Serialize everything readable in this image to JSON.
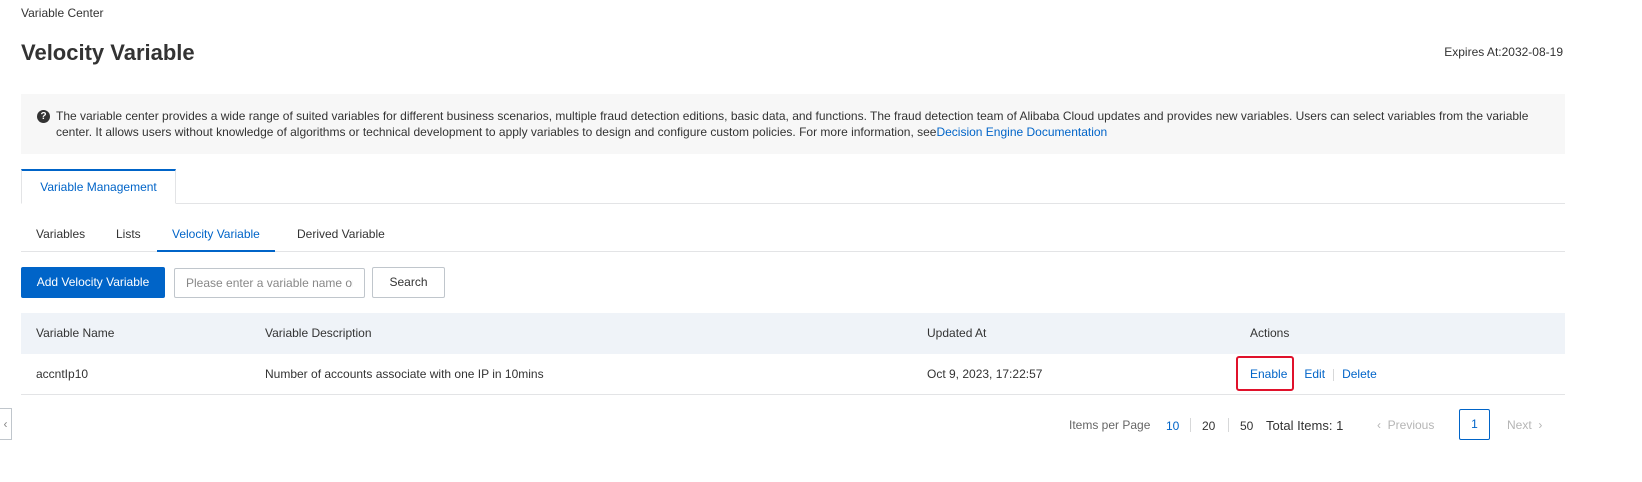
{
  "breadcrumb": "Variable Center",
  "page_title": "Velocity Variable",
  "expires": "Expires At:2032-08-19",
  "info": {
    "icon": "question-circle-icon",
    "text": "The variable center provides a wide range of suited variables for different business scenarios, multiple fraud detection editions, basic data, and functions. The fraud detection team of Alibaba Cloud updates and provides new variables. Users can select variables from the variable center. It allows users without knowledge of algorithms or technical development to apply variables to design and configure custom policies. For more information, see",
    "link": "Decision Engine Documentation"
  },
  "top_tab": "Variable Management",
  "sub_tabs": {
    "variables": "Variables",
    "lists": "Lists",
    "velocity": "Velocity Variable",
    "derived": "Derived Variable"
  },
  "toolbar": {
    "add_label": "Add Velocity Variable",
    "search_placeholder": "Please enter a variable name or",
    "search_label": "Search"
  },
  "table": {
    "headers": {
      "name": "Variable Name",
      "description": "Variable Description",
      "updated": "Updated At",
      "actions": "Actions"
    },
    "rows": [
      {
        "name": "accntIp10",
        "description": "Number of accounts associate with one IP in 10mins",
        "updated": "Oct 9, 2023, 17:22:57",
        "actions": {
          "enable": "Enable",
          "edit": "Edit",
          "delete": "Delete"
        }
      }
    ]
  },
  "pagination": {
    "items_per_page_label": "Items per Page",
    "sizes": [
      "10",
      "20",
      "50"
    ],
    "selected_size": "10",
    "total": "Total Items: 1",
    "prev": "Previous",
    "current_page": "1",
    "next": "Next"
  },
  "colors": {
    "accent": "#0064c8",
    "highlight": "#e0112b"
  }
}
